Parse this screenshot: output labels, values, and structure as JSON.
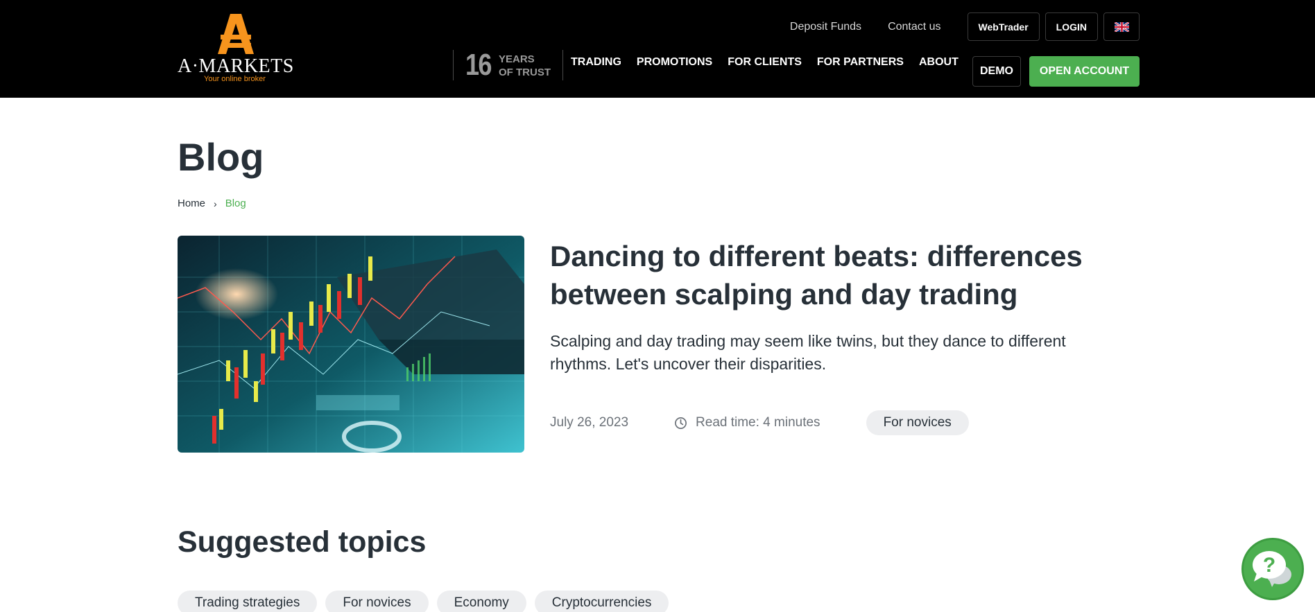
{
  "header": {
    "logo": {
      "wordmark": "A·MARKETS",
      "tagline": "Your online broker"
    },
    "top_links": [
      {
        "label": "Deposit Funds"
      },
      {
        "label": "Contact us"
      }
    ],
    "top_buttons": {
      "webtrader": "WebTrader",
      "login": "LOGIN",
      "language": "uk-flag-icon"
    },
    "trust": {
      "years": "16",
      "line1": "YEARS",
      "line2": "OF TRUST"
    },
    "nav": [
      {
        "label": "TRADING"
      },
      {
        "label": "PROMOTIONS"
      },
      {
        "label": "FOR CLIENTS"
      },
      {
        "label": "FOR PARTNERS"
      },
      {
        "label": "ABOUT"
      }
    ],
    "demo_label": "DEMO",
    "open_account_label": "OPEN ACCOUNT"
  },
  "page": {
    "title": "Blog",
    "breadcrumb": {
      "home": "Home",
      "current": "Blog"
    }
  },
  "featured": {
    "title": "Dancing to different beats: differences between scalping and day trading",
    "excerpt": "Scalping and day trading may seem like twins, but they dance to different rhythms. Let's uncover their disparities.",
    "date": "July 26, 2023",
    "read_time": "Read time: 4 minutes",
    "tag": "For novices",
    "image_icon": "trading-chart-image"
  },
  "suggested": {
    "title": "Suggested topics",
    "topics": [
      "Trading strategies",
      "For novices",
      "Economy",
      "Cryptocurrencies"
    ]
  },
  "chat": {
    "icon": "chat-help-icon"
  },
  "colors": {
    "accent": "#4caf50",
    "header_bg": "#000000",
    "logo_orange": "#f7941d",
    "text": "#273038",
    "pill_bg": "#edeef0"
  }
}
